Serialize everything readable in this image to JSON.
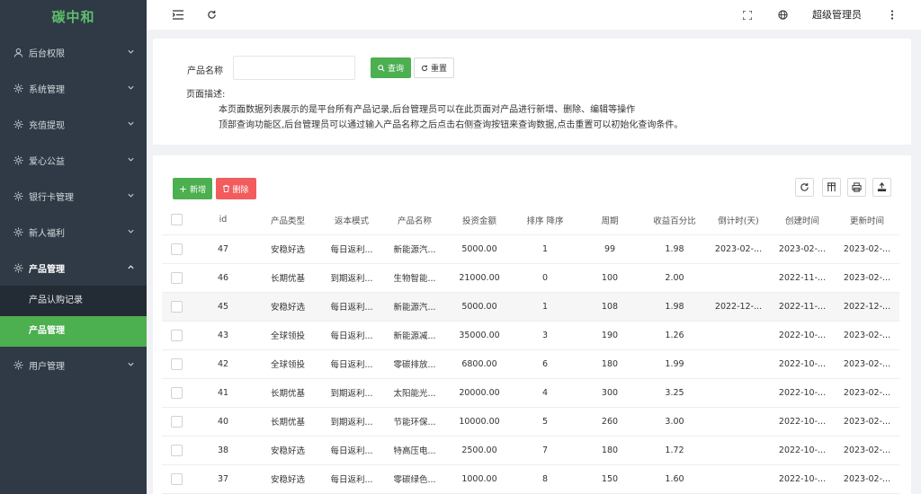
{
  "app": {
    "logo": "碳中和"
  },
  "sidebar": {
    "items": [
      {
        "label": "后台权限",
        "icon": "user-icon"
      },
      {
        "label": "系统管理",
        "icon": "gear-icon"
      },
      {
        "label": "充值提现",
        "icon": "gear-icon"
      },
      {
        "label": "爱心公益",
        "icon": "gear-icon"
      },
      {
        "label": "银行卡管理",
        "icon": "gear-icon"
      },
      {
        "label": "新人福利",
        "icon": "gear-icon"
      },
      {
        "label": "产品管理",
        "icon": "gear-icon",
        "expanded": true,
        "children": [
          {
            "label": "产品认购记录"
          },
          {
            "label": "产品管理",
            "active": true
          }
        ]
      },
      {
        "label": "用户管理",
        "icon": "gear-icon"
      }
    ]
  },
  "header": {
    "admin_name": "超级管理员"
  },
  "search": {
    "label": "产品名称",
    "value": "",
    "placeholder": "",
    "query_label": "查询",
    "reset_label": "重置"
  },
  "description": {
    "title": "页面描述:",
    "line1": "本页面数据列表展示的是平台所有产品记录,后台管理员可以在此页面对产品进行新增、删除、编辑等操作",
    "line2": "顶部查询功能区,后台管理员可以通过输入产品名称之后点击右侧查询按钮来查询数据,点击重置可以初始化查询条件。"
  },
  "toolbar": {
    "add_label": "新增",
    "delete_label": "删除"
  },
  "table": {
    "columns": [
      "id",
      "产品类型",
      "返本模式",
      "产品名称",
      "投资金额",
      "排序 降序",
      "周期",
      "收益百分比",
      "倒计时(天)",
      "创建时间",
      "更新时间"
    ],
    "rows": [
      [
        "47",
        "安稳好选",
        "每日返利...",
        "新能源汽...",
        "5000.00",
        "1",
        "99",
        "1.98",
        "2023-02-...",
        "2023-02-...",
        "2023-02-..."
      ],
      [
        "46",
        "长期优基",
        "到期返利...",
        "生物智能...",
        "21000.00",
        "0",
        "100",
        "2.00",
        "",
        "2022-11-...",
        "2023-02-..."
      ],
      [
        "45",
        "安稳好选",
        "每日返利...",
        "新能源汽...",
        "5000.00",
        "1",
        "108",
        "1.98",
        "2022-12-...",
        "2022-11-...",
        "2022-12-..."
      ],
      [
        "43",
        "全球领投",
        "每日返利...",
        "新能源减...",
        "35000.00",
        "3",
        "190",
        "1.26",
        "",
        "2022-10-...",
        "2023-02-..."
      ],
      [
        "42",
        "全球领投",
        "每日返利...",
        "零碳排放...",
        "6800.00",
        "6",
        "180",
        "1.99",
        "",
        "2022-10-...",
        "2023-02-..."
      ],
      [
        "41",
        "长期优基",
        "到期返利...",
        "太阳能光...",
        "20000.00",
        "4",
        "300",
        "3.25",
        "",
        "2022-10-...",
        "2023-02-..."
      ],
      [
        "40",
        "长期优基",
        "到期返利...",
        "节能环保...",
        "10000.00",
        "5",
        "260",
        "3.00",
        "",
        "2022-10-...",
        "2023-02-..."
      ],
      [
        "38",
        "安稳好选",
        "每日返利...",
        "特高压电...",
        "2500.00",
        "7",
        "180",
        "1.72",
        "",
        "2022-10-...",
        "2023-02-..."
      ],
      [
        "37",
        "安稳好选",
        "每日返利...",
        "零碳绿色...",
        "1000.00",
        "8",
        "150",
        "1.60",
        "",
        "2022-10-...",
        "2023-02-..."
      ]
    ]
  },
  "colors": {
    "accent": "#4caf50",
    "danger": "#f25c5c",
    "sidebar_bg": "#2f3a46",
    "logo": "#5fbf6b"
  }
}
